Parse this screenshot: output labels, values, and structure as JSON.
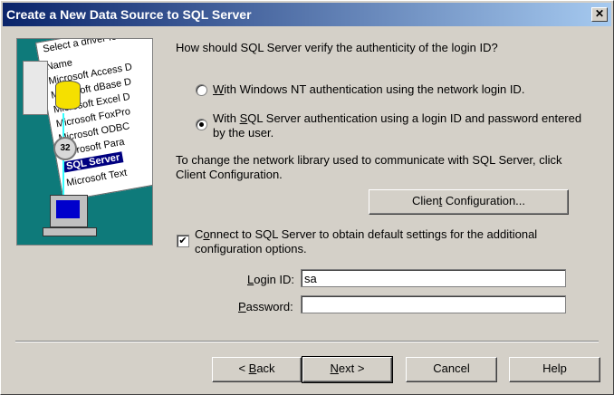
{
  "window": {
    "title": "Create a New Data Source to SQL Server",
    "close_label": "✕"
  },
  "art": {
    "panel_title": "Select a driver fo",
    "panel_header": "Name",
    "items": [
      "Microsoft Access D",
      "Microsoft dBase D",
      "Microsoft Excel D",
      "Microsoft FoxPro",
      "Microsoft ODBC",
      "Microsoft Para",
      "SQL Server",
      "Microsoft Text"
    ],
    "selected_index": 6,
    "gear_label": "32"
  },
  "auth": {
    "question": "How should SQL Server verify the authenticity of the login ID?",
    "option_nt": {
      "prefix": "",
      "hot": "W",
      "rest": "ith Windows NT authentication using the network login ID.",
      "selected": false
    },
    "option_sql": {
      "line1_prefix": "With ",
      "hot": "S",
      "line1_rest": "QL Server authentication using a login ID and password entered",
      "line2": "by the user.",
      "selected": true
    }
  },
  "network": {
    "line1": "To change the network library used to communicate with SQL Server, click",
    "line2": "Client Configuration.",
    "button": {
      "prefix": "Clien",
      "hot": "t",
      "rest": " Configuration..."
    }
  },
  "connect": {
    "checked": true,
    "check_mark": "✔",
    "line1_prefix": "C",
    "hot": "o",
    "line1_rest": "nnect to SQL Server to obtain default settings for the additional",
    "line2": "configuration options."
  },
  "login": {
    "label_prefix": "",
    "hot": "L",
    "label_rest": "ogin ID:",
    "value": "sa"
  },
  "password": {
    "label_prefix": "",
    "hot": "P",
    "label_rest": "assword:",
    "value": ""
  },
  "footer": {
    "back": {
      "prefix": "< ",
      "hot": "B",
      "rest": "ack"
    },
    "next": {
      "prefix": "",
      "hot": "N",
      "rest": "ext >"
    },
    "cancel": "Cancel",
    "help": "Help"
  }
}
